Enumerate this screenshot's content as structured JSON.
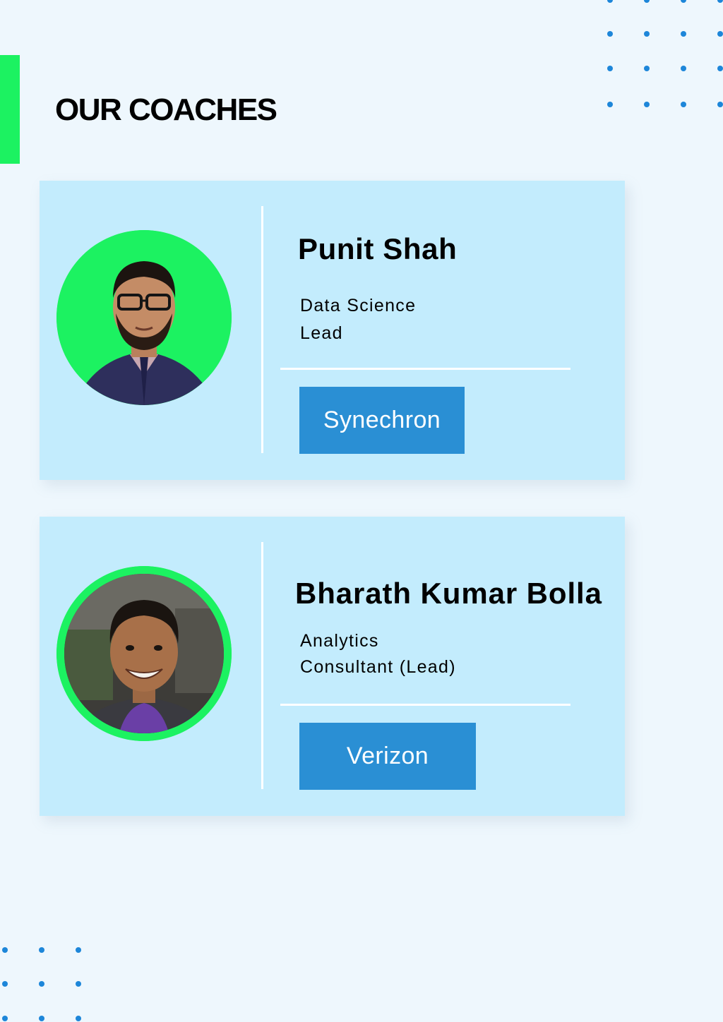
{
  "page": {
    "title": "OUR COACHES"
  },
  "colors": {
    "background": "#eef7fd",
    "accent_green": "#1cf261",
    "card_background": "#c3ecfd",
    "badge_blue": "#2a8fd4",
    "dot_blue": "#1d86d9"
  },
  "coaches": [
    {
      "name": "Punit Shah",
      "role_lines": [
        "Data Science",
        "Lead"
      ],
      "company": "Synechron",
      "photo": "punit-shah-photo"
    },
    {
      "name": "Bharath Kumar Bolla",
      "role_lines": [
        "Analytics",
        "Consultant (Lead)"
      ],
      "company": "Verizon",
      "photo": "bharath-kumar-bolla-photo"
    }
  ]
}
